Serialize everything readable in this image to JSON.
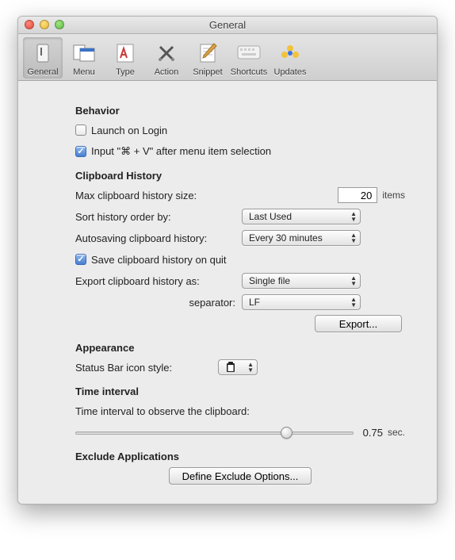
{
  "window": {
    "title": "General"
  },
  "toolbar": {
    "items": [
      {
        "label": "General"
      },
      {
        "label": "Menu"
      },
      {
        "label": "Type"
      },
      {
        "label": "Action"
      },
      {
        "label": "Snippet"
      },
      {
        "label": "Shortcuts"
      },
      {
        "label": "Updates"
      }
    ]
  },
  "behavior": {
    "title": "Behavior",
    "launch_label": "Launch on Login",
    "input_label": "Input \"⌘ + V\" after menu item selection"
  },
  "clipboard": {
    "title": "Clipboard History",
    "max_label": "Max clipboard history size:",
    "max_value": "20",
    "max_unit": "items",
    "sort_label": "Sort history order by:",
    "sort_value": "Last Used",
    "autosave_label": "Autosaving clipboard history:",
    "autosave_value": "Every 30 minutes",
    "savequit_label": "Save clipboard history on quit",
    "export_label": "Export clipboard history as:",
    "export_value": "Single file",
    "separator_label": "separator:",
    "separator_value": "LF",
    "export_btn": "Export..."
  },
  "appearance": {
    "title": "Appearance",
    "status_label": "Status Bar icon style:"
  },
  "timeinterval": {
    "title": "Time interval",
    "label": "Time interval to observe the clipboard:",
    "value": "0.75",
    "unit": "sec.",
    "slider_pos": 0.74
  },
  "exclude": {
    "title": "Exclude Applications",
    "btn": "Define Exclude Options..."
  }
}
